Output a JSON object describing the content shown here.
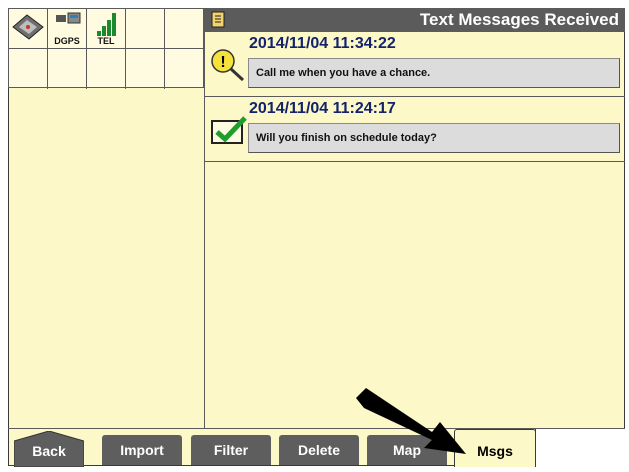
{
  "header": {
    "title": "Text Messages Received",
    "icon": "document-icon"
  },
  "status": {
    "icons": [
      {
        "name": "satellite-signal-icon",
        "label": ""
      },
      {
        "name": "gps-receiver-icon",
        "label": "DGPS"
      },
      {
        "name": "signal-strength-icon",
        "label": "TEL"
      }
    ]
  },
  "messages": [
    {
      "timestamp": "2014/11/04 11:34:22",
      "text": "Call me when you have a chance.",
      "icon": "unread-alert-icon"
    },
    {
      "timestamp": "2014/11/04 11:24:17",
      "text": "Will you finish on schedule today?",
      "icon": "read-check-icon"
    }
  ],
  "tabs": [
    {
      "label": "Back"
    },
    {
      "label": "Import"
    },
    {
      "label": "Filter"
    },
    {
      "label": "Delete"
    },
    {
      "label": "Map"
    },
    {
      "label": "Msgs"
    }
  ],
  "colors": {
    "background": "#fdf8c8",
    "header": "#5b5b5b",
    "tab": "#5e5e5e",
    "timestamp": "#12236b"
  }
}
